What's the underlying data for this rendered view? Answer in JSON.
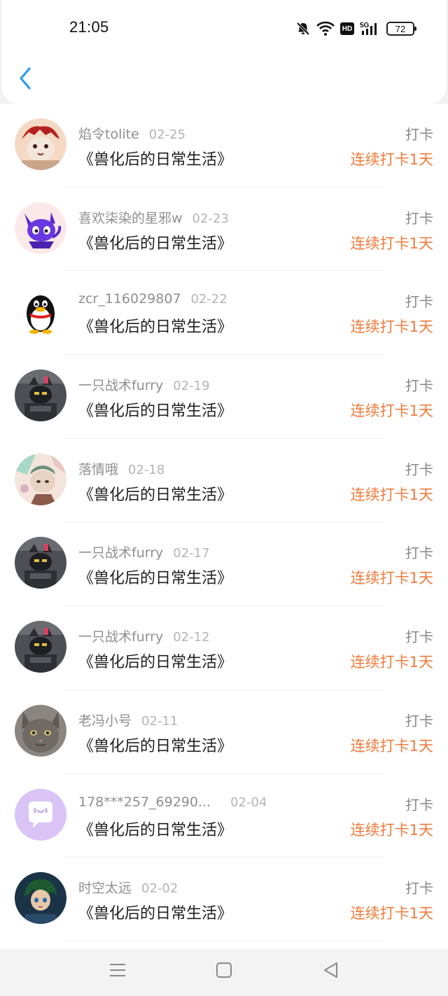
{
  "status_bar": {
    "time": "21:05",
    "network": "5G",
    "hd_badge": "HD",
    "battery": "72"
  },
  "header": {
    "back_icon": "chevron-left-icon"
  },
  "colors": {
    "streak": "#f27a3a",
    "back": "#2b9af3"
  },
  "records": [
    {
      "username": "焰令tolite",
      "date": "02-25",
      "book": "《兽化后的日常生活》",
      "action": "打卡",
      "streak": "连续打卡1天",
      "avatar": "furry-red"
    },
    {
      "username": "喜欢柒染的星邪w",
      "date": "02-23",
      "book": "《兽化后的日常生活》",
      "action": "打卡",
      "streak": "连续打卡1天",
      "avatar": "purple-cat"
    },
    {
      "username": "zcr_116029807",
      "date": "02-22",
      "book": "《兽化后的日常生活》",
      "action": "打卡",
      "streak": "连续打卡1天",
      "avatar": "penguin"
    },
    {
      "username": "一只战术furry",
      "date": "02-19",
      "book": "《兽化后的日常生活》",
      "action": "打卡",
      "streak": "连续打卡1天",
      "avatar": "tactical"
    },
    {
      "username": "落情哦",
      "date": "02-18",
      "book": "《兽化后的日常生活》",
      "action": "打卡",
      "streak": "连续打卡1天",
      "avatar": "pastel"
    },
    {
      "username": "一只战术furry",
      "date": "02-17",
      "book": "《兽化后的日常生活》",
      "action": "打卡",
      "streak": "连续打卡1天",
      "avatar": "tactical"
    },
    {
      "username": "一只战术furry",
      "date": "02-12",
      "book": "《兽化后的日常生活》",
      "action": "打卡",
      "streak": "连续打卡1天",
      "avatar": "tactical"
    },
    {
      "username": "老冯小号",
      "date": "02-11",
      "book": "《兽化后的日常生活》",
      "action": "打卡",
      "streak": "连续打卡1天",
      "avatar": "cat-photo"
    },
    {
      "username": "178***257_69290...",
      "date": "02-04",
      "book": "《兽化后的日常生活》",
      "action": "打卡",
      "streak": "连续打卡1天",
      "avatar": "default-chat"
    },
    {
      "username": "时空太远",
      "date": "02-02",
      "book": "《兽化后的日常生活》",
      "action": "打卡",
      "streak": "连续打卡1天",
      "avatar": "anime-boy"
    }
  ],
  "nav": {
    "menu_icon": "menu-icon",
    "home_icon": "home-square-icon",
    "back_icon": "back-triangle-icon"
  }
}
